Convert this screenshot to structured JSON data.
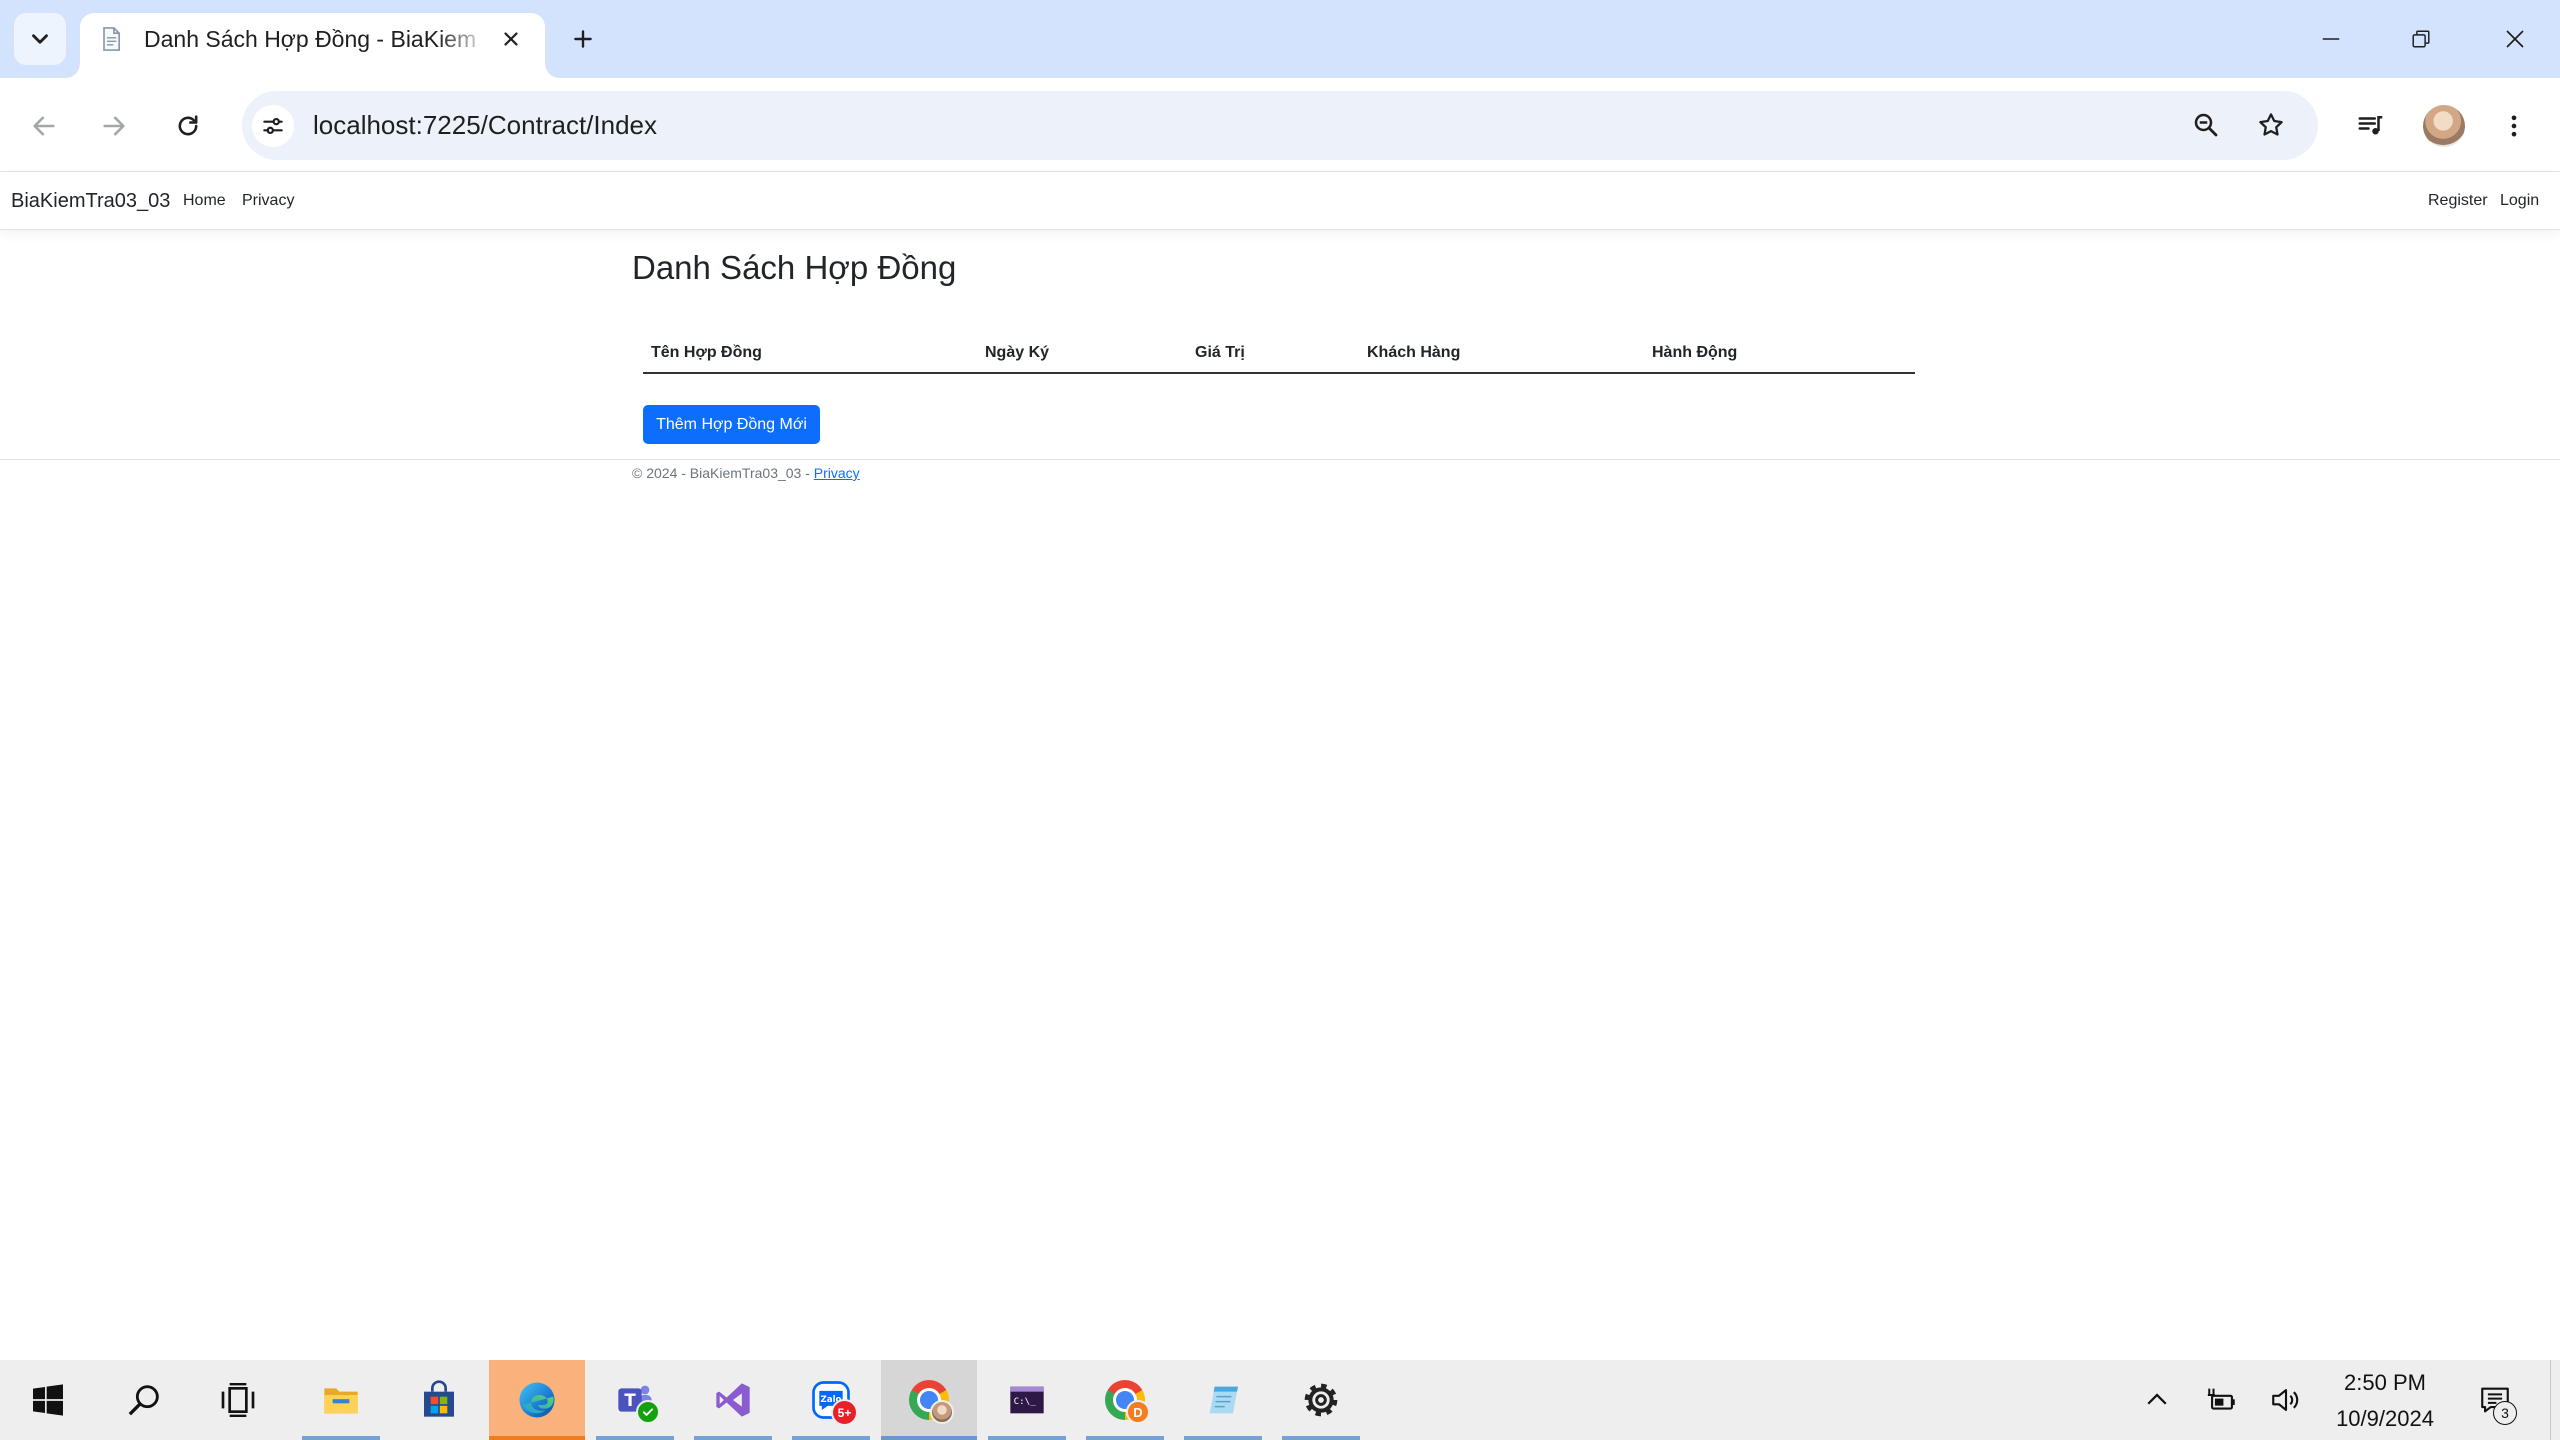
{
  "browser": {
    "tab_search_icon": "chevron-down-icon",
    "tab": {
      "title": "Danh Sách Hợp Đồng - BiaKiem",
      "favicon": "document-icon",
      "close_icon": "close-icon"
    },
    "new_tab_icon": "plus-icon",
    "window_controls": [
      "minimize-icon",
      "restore-icon",
      "close-icon"
    ],
    "nav_icons": [
      "back-arrow-icon",
      "forward-arrow-icon",
      "reload-icon"
    ],
    "back_enabled": false,
    "forward_enabled": false,
    "omnibox": {
      "site_info_icon": "tune-icon",
      "url": "localhost:7225/Contract/Index",
      "action_icons": [
        "zoom-out-icon",
        "star-icon"
      ]
    },
    "toolbar_icons": [
      "media-control-icon",
      "profile-avatar",
      "more-vert-icon"
    ]
  },
  "site": {
    "navbar": {
      "brand": "BiaKiemTra03_03",
      "links": [
        "Home",
        "Privacy"
      ],
      "account_links": [
        "Register",
        "Login"
      ]
    },
    "main": {
      "title": "Danh Sách Hợp Đồng",
      "table": {
        "columns": [
          "Tên Hợp Đồng",
          "Ngày Ký",
          "Giá Trị",
          "Khách Hàng",
          "Hành Động"
        ]
      },
      "add_button": "Thêm Hợp Đồng Mới"
    },
    "footer": {
      "text": "© 2024 - BiaKiemTra03_03 - ",
      "link": "Privacy"
    }
  },
  "taskbar": {
    "apps": [
      {
        "icon": "windows-start-icon",
        "state": "none"
      },
      {
        "icon": "search-icon",
        "state": "none"
      },
      {
        "icon": "task-view-icon",
        "state": "none"
      },
      {
        "icon": "file-explorer-icon",
        "state": "running"
      },
      {
        "icon": "microsoft-store-icon",
        "state": "none"
      },
      {
        "icon": "edge-icon",
        "state": "attention"
      },
      {
        "icon": "teams-icon",
        "state": "running"
      },
      {
        "icon": "visual-studio-icon",
        "state": "running"
      },
      {
        "icon": "zalo-icon",
        "state": "running"
      },
      {
        "icon": "chrome-icon",
        "state": "active"
      },
      {
        "icon": "terminal-icon",
        "state": "running"
      },
      {
        "icon": "chrome-profile-icon",
        "state": "running"
      },
      {
        "icon": "notepad-icon",
        "state": "running"
      },
      {
        "icon": "settings-gear-icon",
        "state": "running"
      }
    ],
    "logo_text": {
      "teams": "T",
      "zalo": "Zalo",
      "terminal": "C:\\_"
    },
    "badges": {
      "zalo": "5+",
      "chrome_profile": "D",
      "notifications": "3"
    },
    "tray_icons": [
      "chevron-up-icon",
      "power-icon",
      "volume-icon",
      "notification-icon"
    ],
    "clock": {
      "time": "2:50 PM",
      "date": "10/9/2024"
    }
  },
  "colors": {
    "accent": "#0d6efd",
    "tab_strip": "#d3e3fd",
    "taskbar": "#eeeeee",
    "edge_attention": "#f9b27c",
    "running_underline": "#76a1d6"
  }
}
